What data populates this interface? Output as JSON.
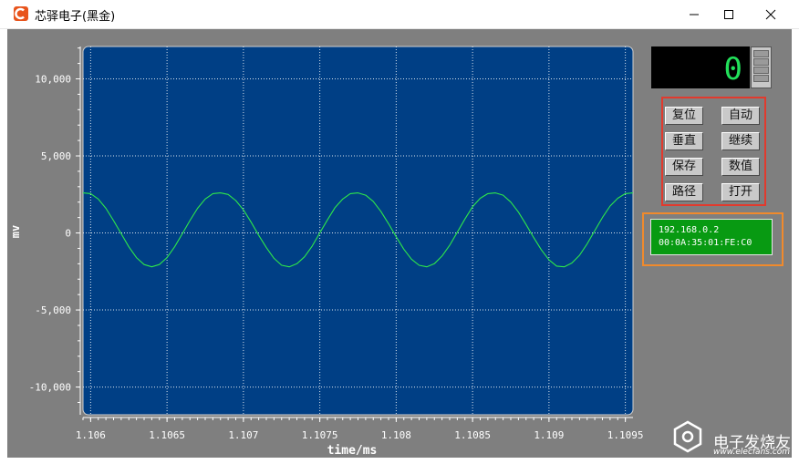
{
  "window": {
    "title": "芯驿电子(黑金)",
    "minimize_icon": "minimize-icon",
    "maximize_icon": "maximize-icon",
    "close_icon": "close-icon"
  },
  "counter": {
    "value": "0"
  },
  "buttons": {
    "reset": "复位",
    "auto": "自动",
    "vertical": "垂直",
    "continue": "继续",
    "save": "保存",
    "numeric": "数值",
    "path": "路径",
    "open": "打开"
  },
  "network": {
    "ip": "192.168.0.2",
    "mac": "00:0A:35:01:FE:C0"
  },
  "watermark": {
    "cn": "电子发烧友",
    "url": "www.elecfans.com"
  },
  "chart_data": {
    "type": "line",
    "xlabel": "time/ms",
    "ylabel": "mv",
    "x_ticks": [
      "1.106",
      "1.1065",
      "1.107",
      "1.1075",
      "1.108",
      "1.1085",
      "1.109",
      "1.1095"
    ],
    "y_ticks": [
      "10,000",
      "5,000",
      "0",
      "-5,000",
      "-10,000"
    ],
    "xlim": [
      1.10595,
      1.10955
    ],
    "ylim": [
      -11800,
      12100
    ],
    "grid": true,
    "series": [
      {
        "x": [
          1.10595,
          1.106,
          1.10605,
          1.1061,
          1.10615,
          1.1062,
          1.10625,
          1.1063,
          1.10635,
          1.1064,
          1.10645,
          1.1065,
          1.10655,
          1.1066,
          1.10665,
          1.1067,
          1.10675,
          1.1068,
          1.10685,
          1.1069,
          1.10695,
          1.107,
          1.10705,
          1.1071,
          1.10715,
          1.1072,
          1.10725,
          1.1073,
          1.10735,
          1.1074,
          1.10745,
          1.1075,
          1.10755,
          1.1076,
          1.10765,
          1.1077,
          1.10775,
          1.1078,
          1.10785,
          1.1079,
          1.10795,
          1.108,
          1.10805,
          1.1081,
          1.10815,
          1.1082,
          1.10825,
          1.1083,
          1.10835,
          1.1084,
          1.10845,
          1.1085,
          1.10855,
          1.1086,
          1.10865,
          1.1087,
          1.10875,
          1.1088,
          1.10885,
          1.1089,
          1.10895,
          1.109,
          1.10905,
          1.1091,
          1.10915,
          1.1092,
          1.10925,
          1.1093,
          1.10935,
          1.1094,
          1.10945,
          1.1095,
          1.10955
        ],
        "y": [
          2600,
          2550,
          2200,
          1600,
          800,
          -50,
          -900,
          -1600,
          -2050,
          -2200,
          -2050,
          -1600,
          -900,
          -50,
          800,
          1600,
          2200,
          2550,
          2600,
          2500,
          2100,
          1500,
          700,
          -150,
          -950,
          -1650,
          -2100,
          -2200,
          -2000,
          -1550,
          -850,
          0,
          850,
          1650,
          2200,
          2550,
          2600,
          2450,
          2050,
          1400,
          600,
          -250,
          -1050,
          -1700,
          -2100,
          -2200,
          -2000,
          -1500,
          -800,
          50,
          900,
          1700,
          2250,
          2550,
          2600,
          2450,
          2000,
          1350,
          550,
          -300,
          -1100,
          -1750,
          -2150,
          -2200,
          -1950,
          -1450,
          -700,
          150,
          1000,
          1750,
          2250,
          2550,
          2600
        ]
      }
    ]
  }
}
